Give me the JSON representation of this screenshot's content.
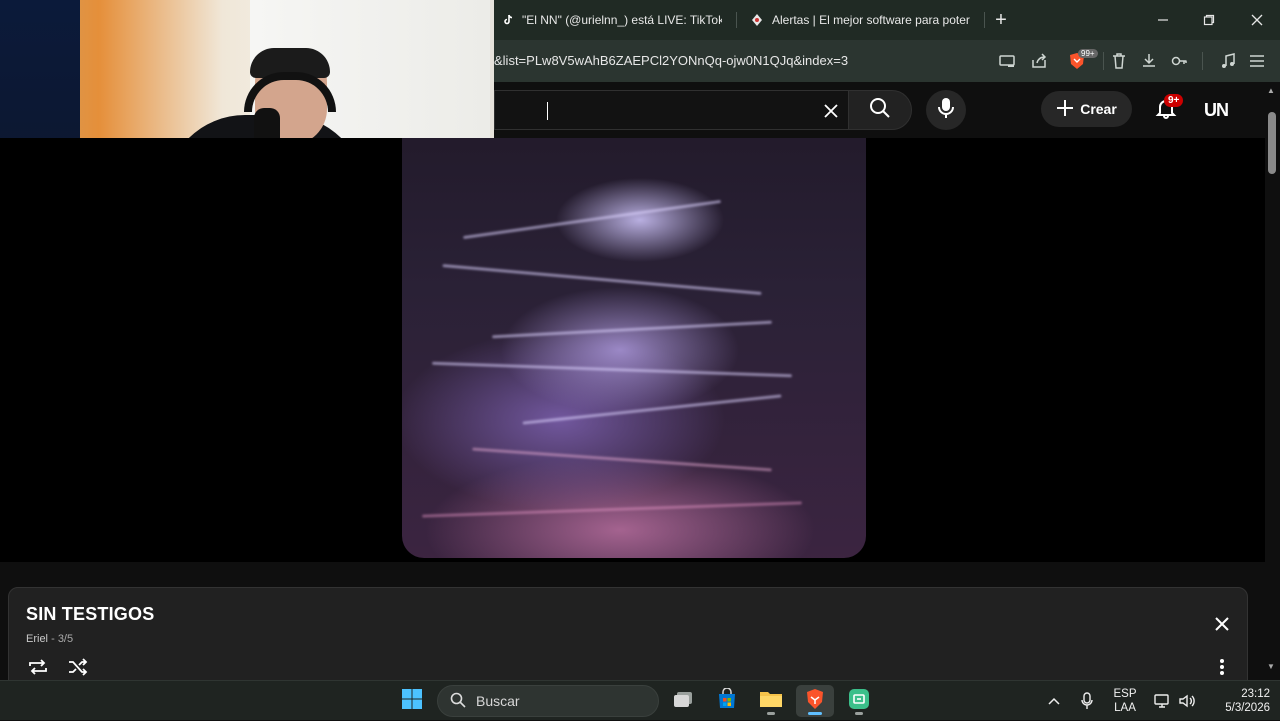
{
  "browser": {
    "tabs": [
      {
        "title": "\"El NN\" (@urielnn_) está LIVE: TikTok",
        "icon": "tiktok-icon"
      },
      {
        "title": "Alertas | El mejor software para poter",
        "icon": "alertas-icon"
      }
    ],
    "new_tab_label": "+",
    "url": "&list=PLw8V5wAhB6ZAEPCl2YONnQq-ojw0N1QJq&index=3",
    "shields_badge": "99+"
  },
  "youtube": {
    "search_value": "",
    "create_label": "Crear",
    "notification_badge": "9+",
    "avatar_text": "UN"
  },
  "now_playing": {
    "title": "SIN TESTIGOS",
    "artist": "Eriel",
    "position": "3/5"
  },
  "taskbar": {
    "search_placeholder": "Buscar",
    "lang_top": "ESP",
    "lang_bottom": "LAA",
    "time": "23:12",
    "date": "5/3/2026"
  },
  "colors": {
    "accent_red": "#cc0000",
    "brave_orange": "#fb542b"
  }
}
